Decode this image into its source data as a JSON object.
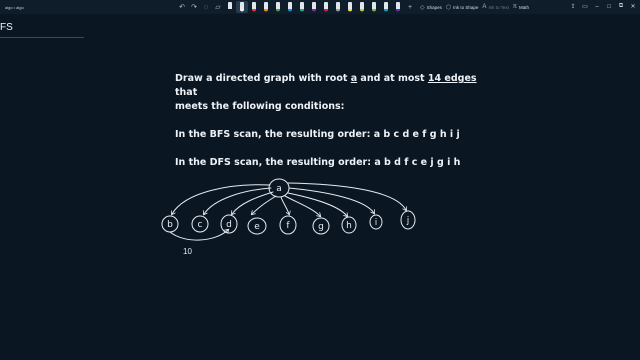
{
  "window": {
    "title": "algo • algo"
  },
  "toolbar": {
    "undo_icon": "undo-icon",
    "redo_icon": "redo-icon",
    "lasso_icon": "lasso-icon",
    "eraser_icon": "eraser-icon",
    "pens": [
      {
        "name": "pen-black",
        "color": "#1b1b1b"
      },
      {
        "name": "pen-white",
        "color": "#f2f2f2"
      },
      {
        "name": "pen-red",
        "color": "#e53935"
      },
      {
        "name": "pen-orange",
        "color": "#fb8c00"
      },
      {
        "name": "pen-green",
        "color": "#43a047"
      },
      {
        "name": "pen-blue",
        "color": "#1e88e5"
      },
      {
        "name": "pen-teal",
        "color": "#26a69a"
      },
      {
        "name": "pen-purple",
        "color": "#8e24aa"
      },
      {
        "name": "pen-pink",
        "color": "#d81b60"
      },
      {
        "name": "pen-gray",
        "color": "#9e9e9e"
      },
      {
        "name": "highlighter-yellow",
        "color": "#fdd835"
      },
      {
        "name": "highlighter-lime",
        "color": "#c0ca33"
      },
      {
        "name": "highlighter-green",
        "color": "#7cb342"
      },
      {
        "name": "highlighter-cyan",
        "color": "#00acc1"
      },
      {
        "name": "highlighter-violet",
        "color": "#5e35b1"
      }
    ],
    "shapes_label": "Shapes",
    "ink_to_shape_label": "Ink to Shape",
    "ink_to_text_label": "Ink to Text",
    "math_label": "Math"
  },
  "page": {
    "heading": "FS"
  },
  "problem": {
    "line1_a": "Draw a directed graph with root ",
    "line1_root": "a",
    "line1_b": " and at most ",
    "line1_edges": "14 edges",
    "line1_c": " that",
    "line2": "meets the following conditions:",
    "bfs": "In the BFS scan, the resulting order: a b c d e f g h i j",
    "dfs": "In the DFS scan, the resulting order: a b d f c e j g i h"
  },
  "ink": {
    "nodes": [
      "a",
      "b",
      "c",
      "d",
      "e",
      "f",
      "g",
      "h",
      "i",
      "j"
    ],
    "edge_label": "10"
  }
}
